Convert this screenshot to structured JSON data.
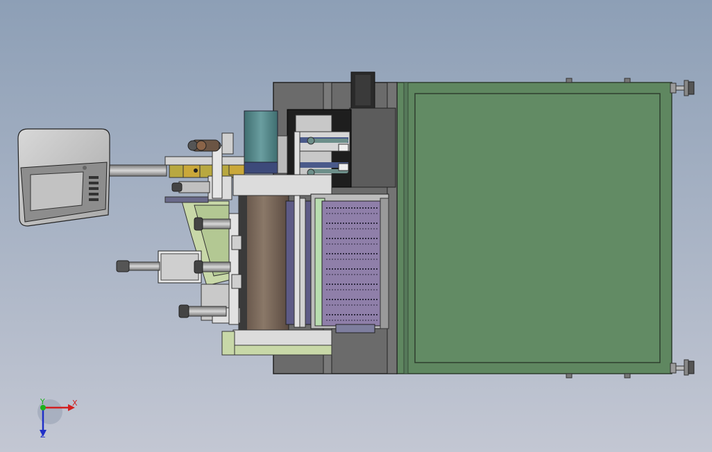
{
  "viewport": {
    "background_top": "#8d9fb6",
    "background_bottom": "#c3c7d3"
  },
  "triad": {
    "x_label": "X",
    "y_label": "Y",
    "z_label": "Z",
    "x_color": "#d22020",
    "y_color": "#1cb21c",
    "z_color": "#2030c8"
  },
  "model": {
    "frame_color": "#5f8760",
    "base_color": "#6b6b6b",
    "fixture_color": "#c8d8a8",
    "motor_color": "#5a8e90"
  }
}
